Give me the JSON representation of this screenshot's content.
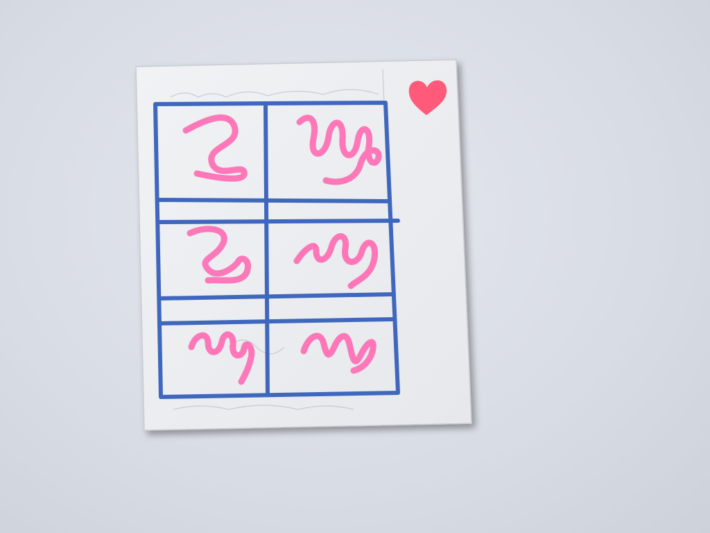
{
  "scene": {
    "description_tag": "photo",
    "background_color": "#d9dde5",
    "card_color": "#eef0f2",
    "grid_color": "#3f67bd",
    "scribble_color": "#ff6eb4",
    "heart_color": "#ff5a7a"
  },
  "grid": {
    "rows": 3,
    "columns": 2,
    "cells": [
      {
        "row": 1,
        "column": 1,
        "content": "pink-squiggle"
      },
      {
        "row": 1,
        "column": 2,
        "content": "pink-squiggle"
      },
      {
        "row": 2,
        "column": 1,
        "content": "pink-squiggle"
      },
      {
        "row": 2,
        "column": 2,
        "content": "pink-squiggle"
      },
      {
        "row": 3,
        "column": 1,
        "content": "pink-squiggle"
      },
      {
        "row": 3,
        "column": 2,
        "content": "pink-squiggle"
      }
    ]
  },
  "icons": {
    "heart": "heart-icon"
  }
}
